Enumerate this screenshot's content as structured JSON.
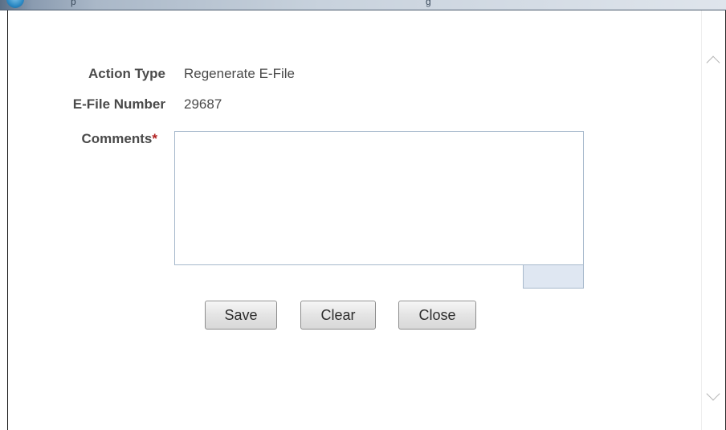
{
  "window": {
    "title_fragment_1": "p",
    "title_fragment_2": "g"
  },
  "form": {
    "action_type": {
      "label": "Action Type",
      "value": "Regenerate E-File"
    },
    "efile_number": {
      "label": "E-File Number",
      "value": "29687"
    },
    "comments": {
      "label": "Comments",
      "required_marker": "*",
      "value": ""
    }
  },
  "buttons": {
    "save": "Save",
    "clear": "Clear",
    "close": "Close"
  },
  "icons": {
    "window": "app-icon",
    "scroll_up": "chevron-up-icon",
    "scroll_down": "chevron-down-icon"
  },
  "colors": {
    "required": "#b22222",
    "textarea_border": "#a7b9cc",
    "counter_bg": "#dfe7f2"
  }
}
